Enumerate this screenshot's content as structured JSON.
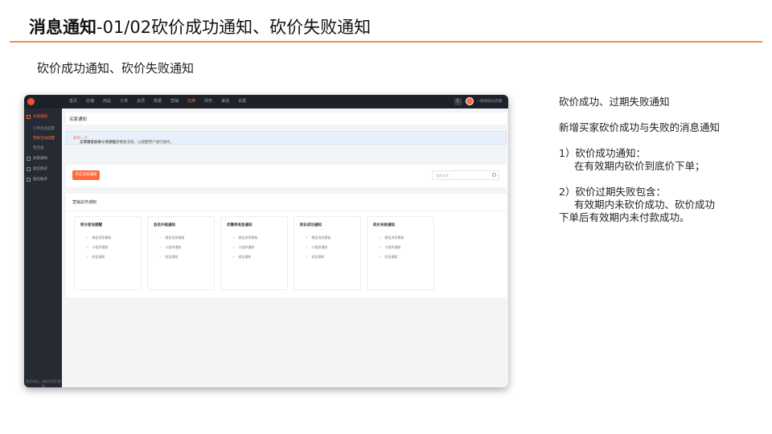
{
  "slide": {
    "title_bold": "消息通知",
    "title_rest": "-01/02砍价成功通知、砍价失败通知",
    "subheading": "砍价成功通知、砍价失败通知"
  },
  "app": {
    "nav": [
      "首页",
      "店铺",
      "商品",
      "订单",
      "会员",
      "数据",
      "营销",
      "应用",
      "财务",
      "渠道",
      "设置"
    ],
    "active_nav": "应用",
    "top_right": {
      "chip": "1",
      "name": "一帆的砍价店铺"
    },
    "sidebar": {
      "group_main": "买家通知",
      "sub_items": [
        "订单状态提醒",
        "营销活动提醒",
        "售后类"
      ],
      "group_2": "商家通知",
      "group_3": "短信购买",
      "group_4": "短信账单",
      "footer": "更多帮助，请联系我们客服"
    },
    "page_title": "买家通知",
    "notice": {
      "text_before": "基于微信公众号或小程序模板消息，以提醒用户进行操作，",
      "link": "如何一下",
      "text_after": "，或请参照第一下模板。"
    },
    "primary_button": "开启消息通知",
    "search_placeholder": "搜索名称",
    "panel_title": "营销关怀通知",
    "cards": [
      {
        "title": "积分变动提醒",
        "items": [
          "微信消息模板",
          "小程序通知",
          "短信通知"
        ]
      },
      {
        "title": "会员升级通知",
        "items": [
          "微信消息模板",
          "小程序通知",
          "短信通知"
        ]
      },
      {
        "title": "优惠券发放通知",
        "items": [
          "微信消息模板",
          "小程序通知",
          "短信通知"
        ]
      },
      {
        "title": "砍价成功通知",
        "items": [
          "微信消息模板",
          "小程序通知",
          "短信通知"
        ]
      },
      {
        "title": "砍价失败通知",
        "items": [
          "微信消息模板",
          "小程序通知",
          "短信通知"
        ]
      }
    ],
    "check_mark": "✓"
  },
  "notes": {
    "line1": "砍价成功、过期失败通知",
    "line2": "新增买家砍价成功与失败的消息通知",
    "item1_title": "1）砍价成功通知：",
    "item1_body": "在有效期内砍价到底价下单；",
    "item2_title": "2）砍价过期失败包含：",
    "item2_body1": "有效期内未砍价成功、砍价成功",
    "item2_body2": "下单后有效期内未付款成功。"
  }
}
